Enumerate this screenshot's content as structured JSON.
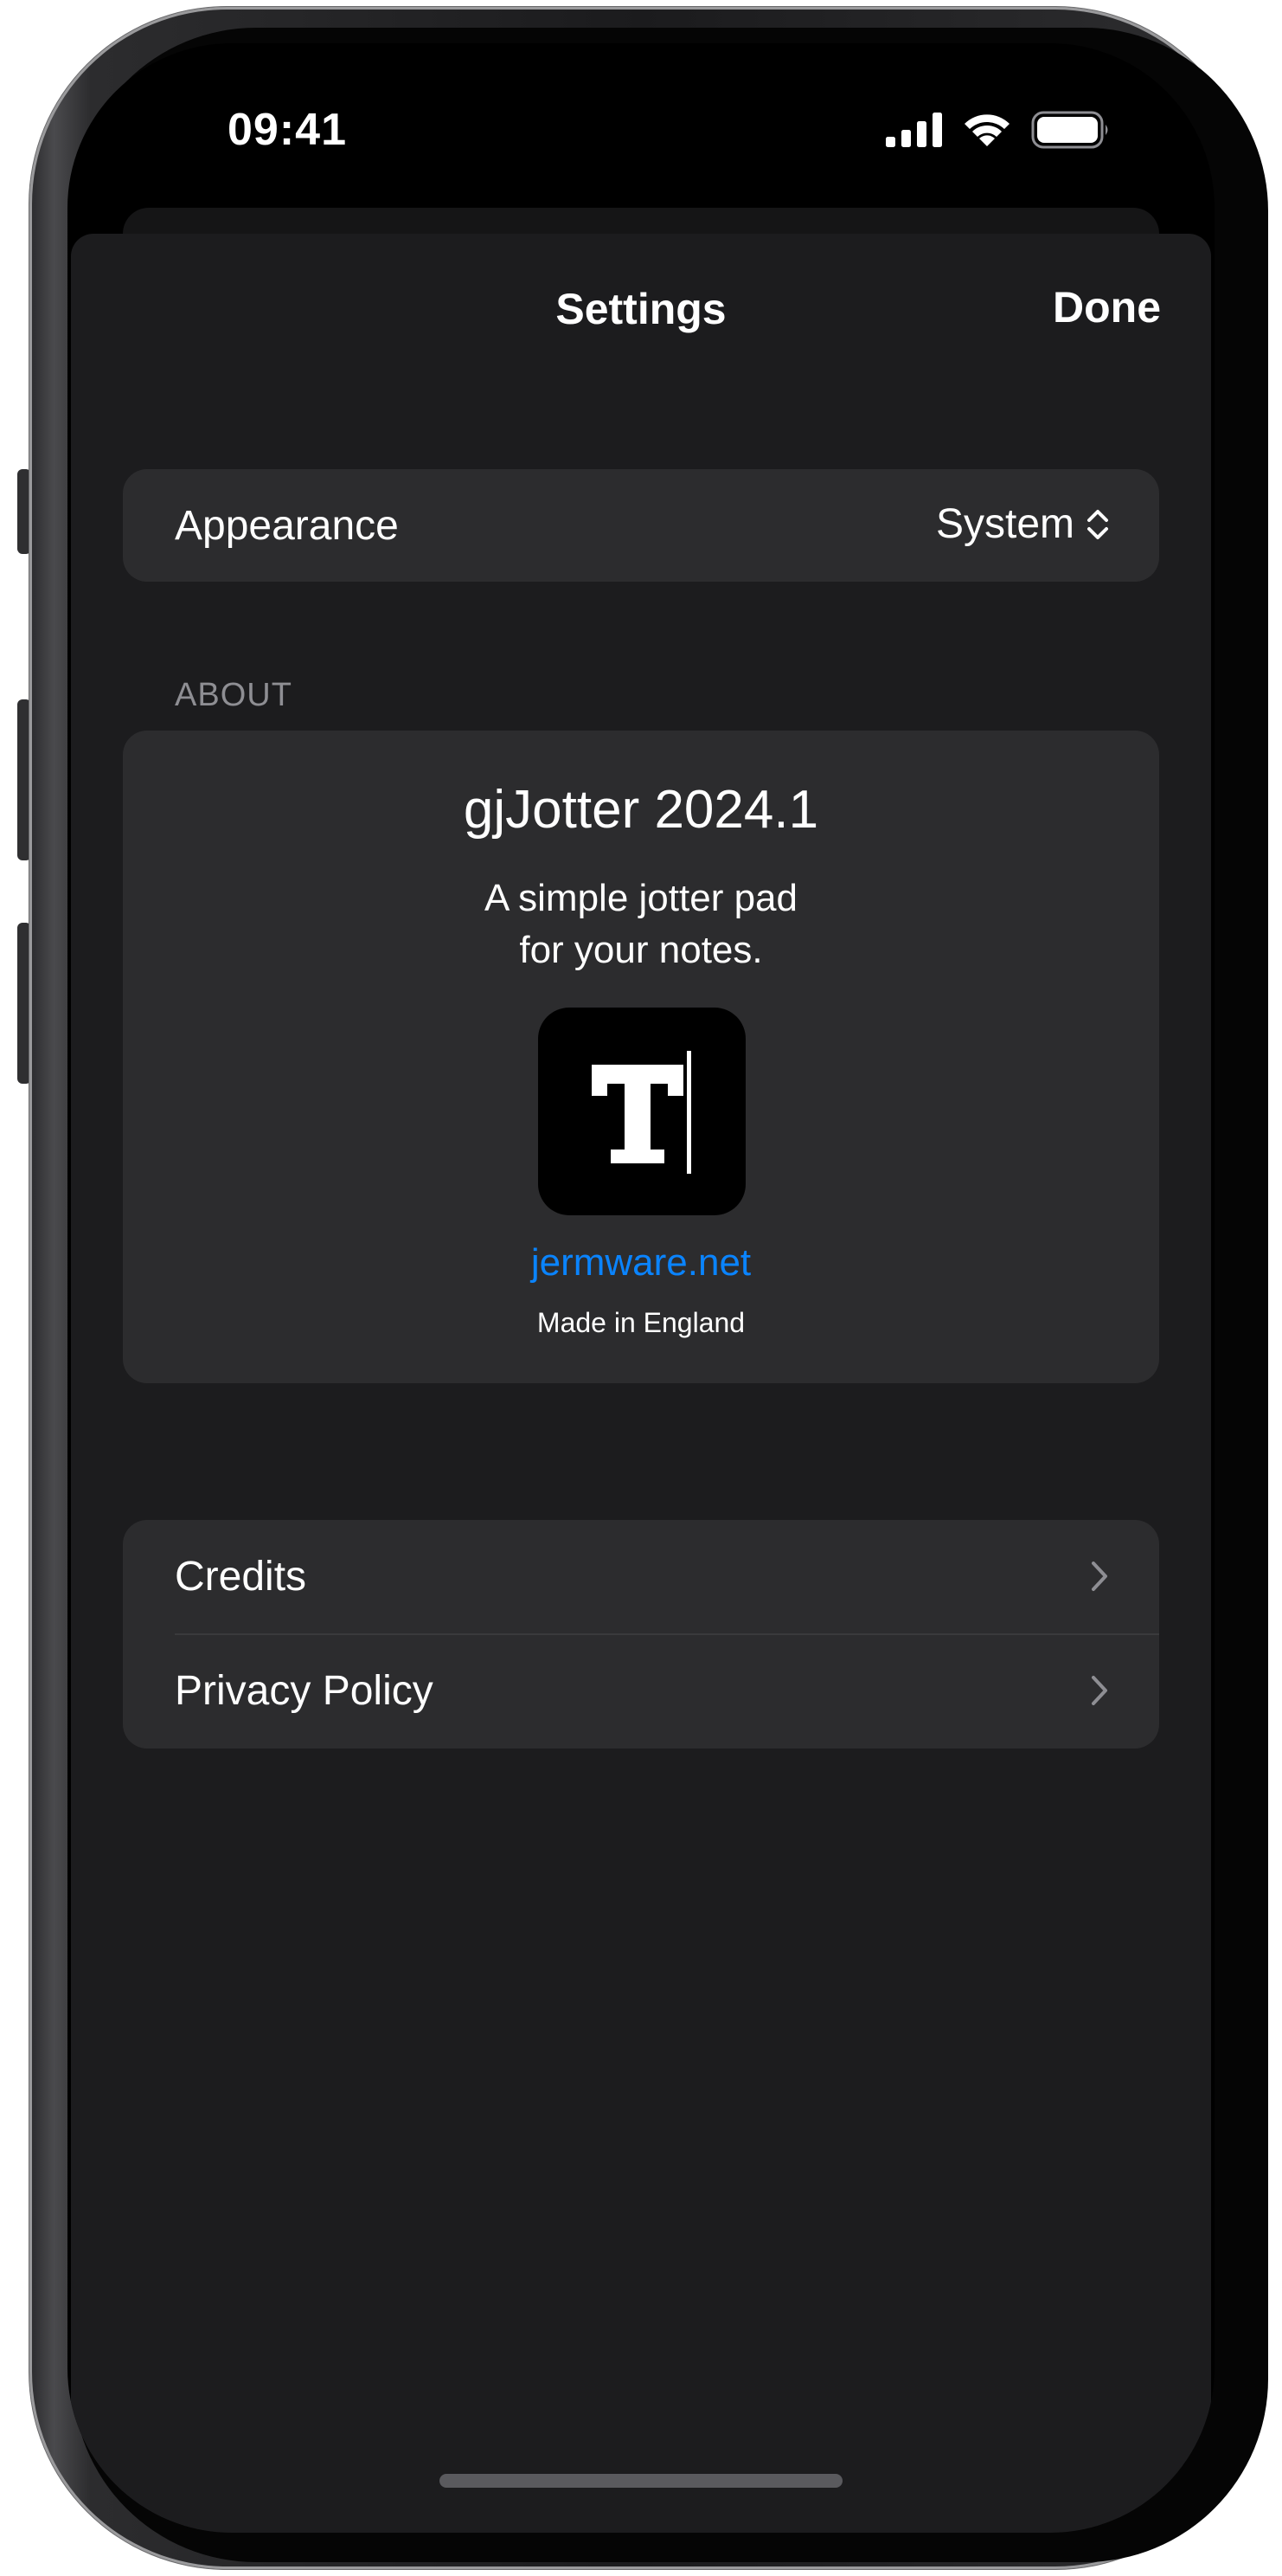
{
  "status_bar": {
    "time": "09:41",
    "icons": [
      "cellular-signal-icon",
      "wifi-icon",
      "battery-icon"
    ]
  },
  "nav": {
    "title": "Settings",
    "done_label": "Done"
  },
  "appearance": {
    "label": "Appearance",
    "value": "System",
    "options_icon": "chevron-up-down-icon"
  },
  "about": {
    "section_header": "ABOUT",
    "app_name": "gjJotter 2024.1",
    "tagline_line1": "A simple jotter pad",
    "tagline_line2": "for your notes.",
    "app_icon": "app-icon-letter-t-with-cursor",
    "link": "jermware.net",
    "origin": "Made in England"
  },
  "links": {
    "items": [
      {
        "label": "Credits",
        "icon": "chevron-right-icon"
      },
      {
        "label": "Privacy Policy",
        "icon": "chevron-right-icon"
      }
    ]
  },
  "colors": {
    "sheet_background": "#1c1c1e",
    "group_background": "#2c2c2e",
    "text_primary": "#ffffff",
    "text_secondary": "#8e8e93",
    "link": "#0a84ff"
  }
}
